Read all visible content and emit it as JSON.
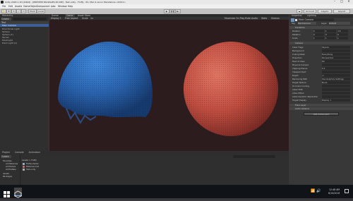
{
  "window": {
    "title": "Unity 2018.1.1f1 (64bit) - [PREVIEW PACKAGES IN USE] - Test.unity - Fluffy - PC, Mac & Linux Standalone <DX11>",
    "controls": [
      "–",
      "□",
      "✕"
    ]
  },
  "menu": [
    "File",
    "Edit",
    "Assets",
    "GameObject",
    "Component",
    "Jobs",
    "Window",
    "Help"
  ],
  "toolbar": {
    "pivot": "Pivot",
    "local": "Local",
    "account": "Account",
    "layers": "Layers",
    "layout": "Layout"
  },
  "hierarchy": {
    "tab": "Hierarchy",
    "create": "Create",
    "scene": "Test",
    "items": [
      "Main Camera",
      "Directional Light",
      "Sphere",
      "Sphere (1)",
      "Terrain",
      "PointLight",
      "Point Light (1)"
    ]
  },
  "scene_view": {
    "tabs": [
      "Scene",
      "Game",
      "Asset Store"
    ],
    "display": "Display 1",
    "aspect": "Free Aspect",
    "scale": "Scale",
    "scale_value": "1x",
    "options": [
      "Maximize On Play",
      "Mute Audio",
      "Stats",
      "Gizmos"
    ]
  },
  "inspector": {
    "tabs": [
      "Inspector",
      "Lighting"
    ],
    "object_name": "Main Camera",
    "tag_label": "Tag",
    "tag": "MainCamera",
    "layer_label": "Layer",
    "layer": "Default",
    "transform_header": "Transform",
    "transform_rows": [
      {
        "label": "Position",
        "x": "0",
        "y": "1",
        "z": "-10"
      },
      {
        "label": "Rotation",
        "x": "0",
        "y": "0",
        "z": "0"
      },
      {
        "label": "Scale",
        "x": "1",
        "y": "1",
        "z": "1"
      }
    ],
    "camera_header": "Camera",
    "camera_rows": [
      {
        "label": "Clear Flags",
        "value": "Skybox"
      },
      {
        "label": "Background",
        "value": ""
      },
      {
        "label": "Culling Mask",
        "value": "Everything"
      },
      {
        "label": "Projection",
        "value": "Perspective"
      },
      {
        "label": "Field of View",
        "value": "60"
      },
      {
        "label": "Physical Camera",
        "value": ""
      },
      {
        "label": "Clipping Planes",
        "value": "0.3"
      },
      {
        "label": "Viewport Rect",
        "value": ""
      },
      {
        "label": "Depth",
        "value": "-1"
      },
      {
        "label": "Rendering Path",
        "value": "Use Graphics Settings"
      },
      {
        "label": "Target Texture",
        "value": "None"
      },
      {
        "label": "Occlusion Culling",
        "value": ""
      },
      {
        "label": "Allow HDR",
        "value": ""
      },
      {
        "label": "Allow MSAA",
        "value": ""
      },
      {
        "label": "Allow Dynamic Resolution",
        "value": ""
      },
      {
        "label": "Target Display",
        "value": "Display 1"
      }
    ],
    "flare_header": "Flare Layer",
    "listener_header": "Audio Listener",
    "add_component": "Add Component"
  },
  "project": {
    "tabs": [
      "Project",
      "Console",
      "Animation"
    ],
    "create": "Create",
    "tree": [
      "Favorites",
      "All Materials",
      "All Models",
      "All Prefabs",
      "Assets",
      "Packages"
    ],
    "breadcrumb": "Assets > Fluffy",
    "files": [
      "Fluffy.shader",
      "Material.mat",
      "Test.unity"
    ]
  },
  "taskbar": {
    "time": "12:48 AM",
    "date": "6/10/2018"
  },
  "colors": {
    "scene_bg": "#2d1d1e",
    "sphere_blue": "#2f6fc0",
    "sphere_red": "#c9564a",
    "accent": "#4a7fd0"
  }
}
